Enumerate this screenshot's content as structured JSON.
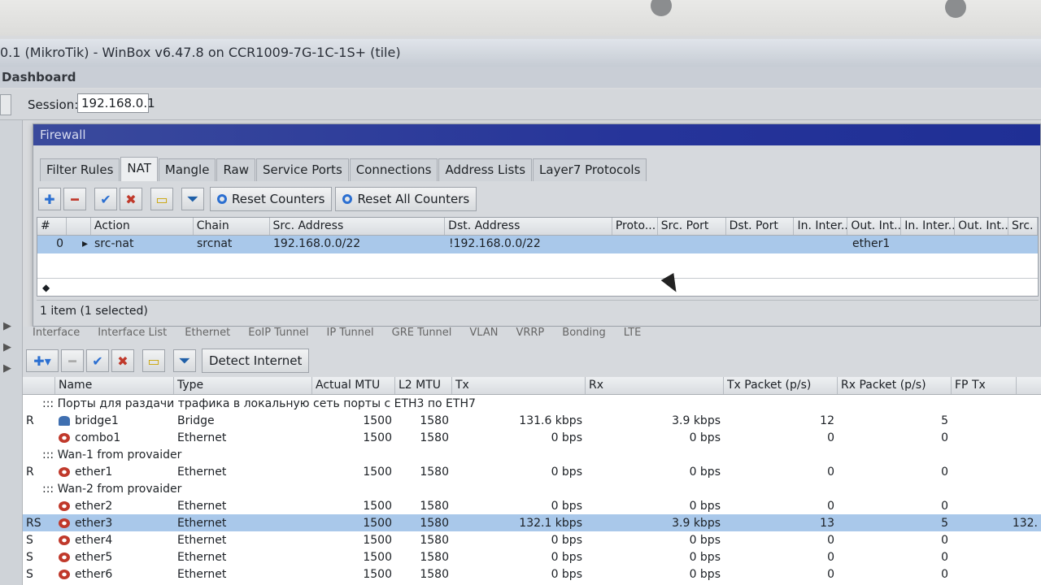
{
  "window": {
    "title": "0.1 (MikroTik) - WinBox v6.47.8 on CCR1009-7G-1C-1S+ (tile)",
    "menu_title": "Dashboard",
    "session_label": "Session:",
    "session_value": "192.168.0.1"
  },
  "firewall": {
    "title": "Firewall",
    "tabs": [
      "Filter Rules",
      "NAT",
      "Mangle",
      "Raw",
      "Service Ports",
      "Connections",
      "Address Lists",
      "Layer7 Protocols"
    ],
    "active_tab": "NAT",
    "buttons": {
      "reset_counters": "Reset Counters",
      "reset_all_counters": "Reset All Counters"
    },
    "columns": [
      "#",
      "Action",
      "Chain",
      "Src. Address",
      "Dst. Address",
      "Proto...",
      "Src. Port",
      "Dst. Port",
      "In. Inter...",
      "Out. Int...",
      "In. Inter...",
      "Out. Int...",
      "Src."
    ],
    "rows": [
      {
        "num": "0",
        "action": "src-nat",
        "chain": "srcnat",
        "src_address": "192.168.0.0/22",
        "dst_address": "!192.168.0.0/22",
        "out_interface": "ether1"
      }
    ],
    "status": "1 item (1 selected)"
  },
  "interfaces": {
    "tabs": [
      "Interface",
      "Interface List",
      "Ethernet",
      "EoIP Tunnel",
      "IP Tunnel",
      "GRE Tunnel",
      "VLAN",
      "VRRP",
      "Bonding",
      "LTE"
    ],
    "detect_internet": "Detect Internet",
    "columns": [
      "Name",
      "Type",
      "Actual MTU",
      "L2 MTU",
      "Tx",
      "Rx",
      "Tx Packet (p/s)",
      "Rx Packet (p/s)",
      "FP Tx"
    ],
    "rows": [
      {
        "comment": "::: Порты для раздачи трафика в локальную сеть порты с ETH3 по ETH7"
      },
      {
        "flag": "R",
        "icon": "bridge",
        "name": "bridge1",
        "type": "Bridge",
        "mtu": "1500",
        "l2mtu": "1580",
        "tx": "131.6 kbps",
        "rx": "3.9 kbps",
        "txp": "12",
        "rxp": "5",
        "fptx": ""
      },
      {
        "flag": "",
        "icon": "ethernet",
        "name": "combo1",
        "type": "Ethernet",
        "mtu": "1500",
        "l2mtu": "1580",
        "tx": "0 bps",
        "rx": "0 bps",
        "txp": "0",
        "rxp": "0",
        "fptx": ""
      },
      {
        "comment": "::: Wan-1 from provaider"
      },
      {
        "flag": "R",
        "icon": "ethernet",
        "name": "ether1",
        "type": "Ethernet",
        "mtu": "1500",
        "l2mtu": "1580",
        "tx": "0 bps",
        "rx": "0 bps",
        "txp": "0",
        "rxp": "0",
        "fptx": ""
      },
      {
        "comment": "::: Wan-2 from provaider"
      },
      {
        "flag": "",
        "icon": "ethernet",
        "name": "ether2",
        "type": "Ethernet",
        "mtu": "1500",
        "l2mtu": "1580",
        "tx": "0 bps",
        "rx": "0 bps",
        "txp": "0",
        "rxp": "0",
        "fptx": ""
      },
      {
        "flag": "RS",
        "icon": "ethernet",
        "name": "ether3",
        "type": "Ethernet",
        "mtu": "1500",
        "l2mtu": "1580",
        "tx": "132.1 kbps",
        "rx": "3.9 kbps",
        "txp": "13",
        "rxp": "5",
        "fptx": "132.",
        "selected": true
      },
      {
        "flag": "S",
        "icon": "ethernet",
        "name": "ether4",
        "type": "Ethernet",
        "mtu": "1500",
        "l2mtu": "1580",
        "tx": "0 bps",
        "rx": "0 bps",
        "txp": "0",
        "rxp": "0",
        "fptx": ""
      },
      {
        "flag": "S",
        "icon": "ethernet",
        "name": "ether5",
        "type": "Ethernet",
        "mtu": "1500",
        "l2mtu": "1580",
        "tx": "0 bps",
        "rx": "0 bps",
        "txp": "0",
        "rxp": "0",
        "fptx": ""
      },
      {
        "flag": "S",
        "icon": "ethernet",
        "name": "ether6",
        "type": "Ethernet",
        "mtu": "1500",
        "l2mtu": "1580",
        "tx": "0 bps",
        "rx": "0 bps",
        "txp": "0",
        "rxp": "0",
        "fptx": ""
      }
    ]
  },
  "colors": {
    "selection": "#a9c8ea",
    "titlebar": "#26349a",
    "add": "#2b6fd1",
    "remove": "#c0392b"
  }
}
